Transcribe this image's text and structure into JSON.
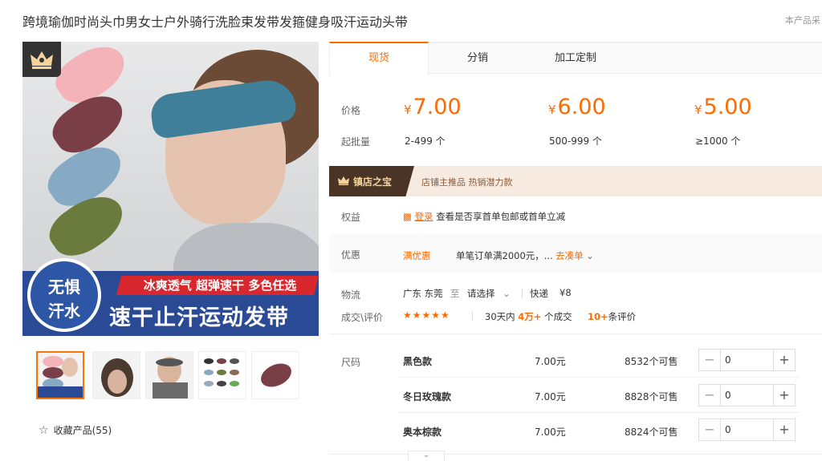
{
  "product": {
    "title": "跨境瑜伽时尚头巾男女士户外骑行洗脸束发带发箍健身吸汗运动头带",
    "note": "本产品采"
  },
  "gallery": {
    "banner": {
      "circle_line1": "无惧",
      "circle_line2": "汗水",
      "red_text": "冰爽透气 超弹速干 多色任选",
      "blue_text": "速干止汗运动发带"
    },
    "zoom_icon": "search-icon",
    "thumbnails": [
      "thumb-1",
      "thumb-2",
      "thumb-3",
      "thumb-4",
      "thumb-5"
    ],
    "favorite_label": "收藏产品(55)"
  },
  "tabs": [
    {
      "label": "现货",
      "active": true
    },
    {
      "label": "分销",
      "active": false
    },
    {
      "label": "加工定制",
      "active": false
    }
  ],
  "pricing": {
    "price_label": "价格",
    "moq_label": "起批量",
    "currency": "¥",
    "tiers": [
      {
        "price": "7.00",
        "range": "2-499 个"
      },
      {
        "price": "6.00",
        "range": "500-999 个"
      },
      {
        "price": "5.00",
        "range": "≥1000 个"
      }
    ]
  },
  "promo": {
    "badge": "镇店之宝",
    "text": "店铺主推品  热销潜力款"
  },
  "benefits": {
    "label": "权益",
    "login_link": "登录",
    "text": "查看是否享首单包邮或首单立减"
  },
  "discount": {
    "label": "优惠",
    "tag": "满优惠",
    "text": "单笔订单满2000元，...",
    "action": "去凑单"
  },
  "logistics": {
    "label": "物流",
    "from": "广东 东莞",
    "to_word": "至",
    "select": "请选择",
    "method": "快递",
    "fee": "¥8"
  },
  "reviews": {
    "label": "成交\\评价",
    "stars": "★★★★★",
    "days_text": "30天内",
    "deals": "4万+",
    "deals_suffix": "个成交",
    "count": "10+",
    "count_suffix": "条评价"
  },
  "sku": {
    "label": "尺码",
    "items": [
      {
        "name": "黑色款",
        "price": "7.00元",
        "stock": "8532个可售",
        "qty": "0"
      },
      {
        "name": "冬日玫瑰款",
        "price": "7.00元",
        "stock": "8828个可售",
        "qty": "0"
      },
      {
        "name": "奥本棕款",
        "price": "7.00元",
        "stock": "8824个可售",
        "qty": "0"
      }
    ],
    "minus": "−",
    "plus": "+"
  },
  "colors": {
    "accent": "#ff6a00",
    "banner_blue": "#2a4a95",
    "banner_red": "#d8282e",
    "promo_dark": "#4a3426"
  }
}
